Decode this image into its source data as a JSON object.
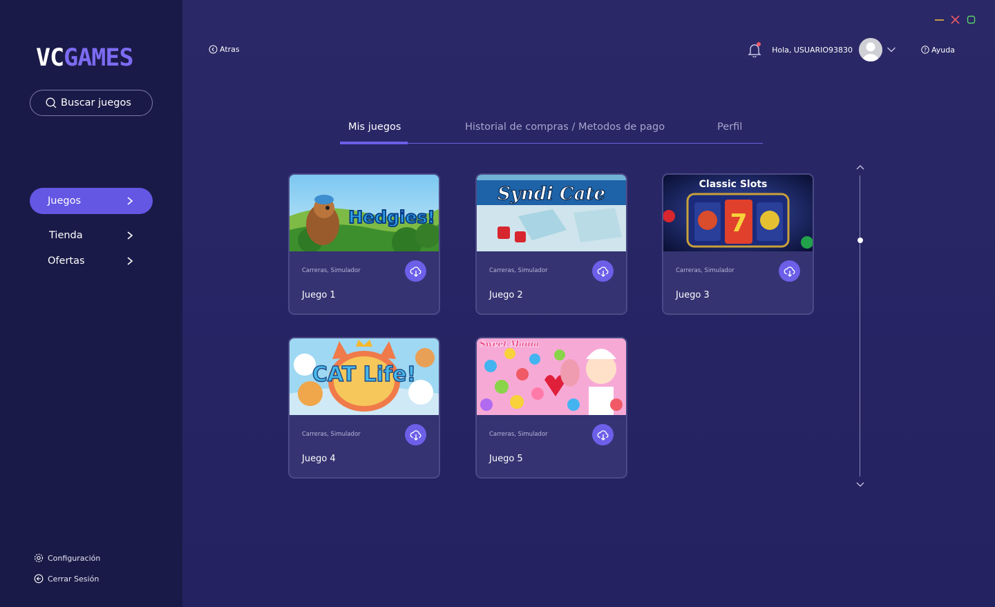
{
  "window": {
    "minimize_color": "#f2b542",
    "close_color": "#f05a66",
    "maximize_color": "#5bd36b"
  },
  "sidebar": {
    "logo_part1": "VC",
    "logo_part2": "GAMES",
    "search_placeholder": "Buscar juegos",
    "nav": [
      {
        "label": "Juegos",
        "active": true
      },
      {
        "label": "Tienda",
        "active": false
      },
      {
        "label": "Ofertas",
        "active": false
      }
    ],
    "settings_label": "Configuración",
    "logout_label": "Cerrar Sesión"
  },
  "header": {
    "back_label": "Atras",
    "greeting": "Hola, USUARIO93830",
    "help_label": "Ayuda"
  },
  "tabs": [
    {
      "label": "Mis juegos",
      "active": true
    },
    {
      "label": "Historial de compras / Metodos de pago",
      "active": false
    },
    {
      "label": "Perfil",
      "active": false
    }
  ],
  "games": [
    {
      "title": "Juego 1",
      "genre": "Carreras, Simulador",
      "art": "Hedgies!"
    },
    {
      "title": "Juego 2",
      "genre": "Carreras, Simulador",
      "art": "Syndi Cate"
    },
    {
      "title": "Juego 3",
      "genre": "Carreras, Simulador",
      "art": "Classic Slots"
    },
    {
      "title": "Juego 4",
      "genre": "Carreras, Simulador",
      "art": "CAT Life!"
    },
    {
      "title": "Juego 5",
      "genre": "Carreras, Simulador",
      "art": "Sweet Mania"
    }
  ],
  "colors": {
    "accent": "#6c5fe8",
    "sidebar_bg": "#1a1a48",
    "card_bg": "#353372"
  }
}
